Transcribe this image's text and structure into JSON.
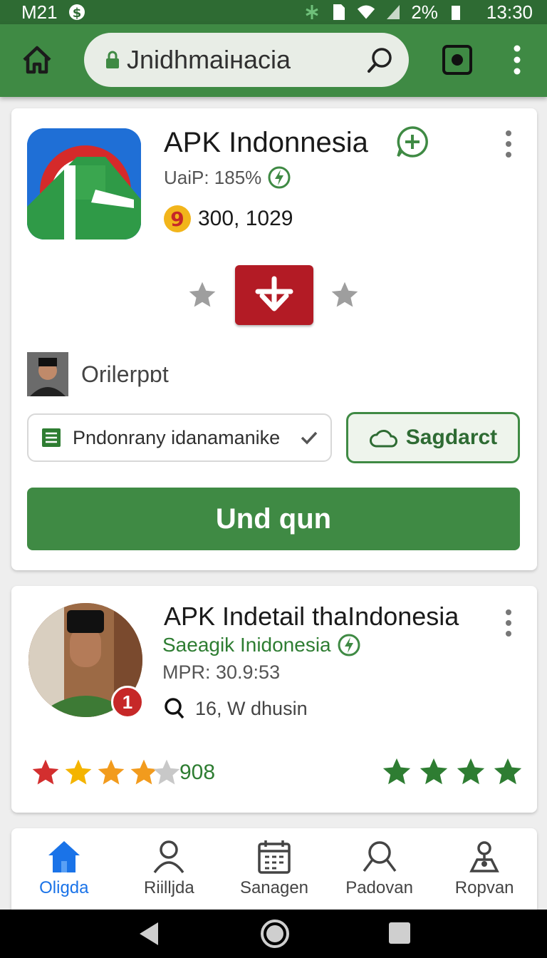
{
  "status_bar": {
    "carrier": "M21",
    "battery": "2%",
    "time": "13:30"
  },
  "toolbar": {
    "url": "Jnidhmaiнacia"
  },
  "app_card": {
    "title": "APK Indonnesia",
    "subtitle": "UaiP: 185%",
    "coins": "300, 1029",
    "author": "Orilerpɒt",
    "chip_left_label": "Pndonrany idanamanike",
    "chip_right_label": "Sagdarct",
    "main_button_label": "Und qun"
  },
  "detail_card": {
    "title": "APK Indetail  thaIndonesia",
    "subtitle": "Saeagik Inidonesia",
    "mpr": "MPR: 30.9:53",
    "search_line": "16, W dhusin",
    "badge": "1",
    "rating_count": "908",
    "left_rating_stars": 4,
    "right_rating_stars": 4
  },
  "bottom_nav": {
    "items": [
      {
        "label": "Oligda",
        "icon": "home-icon",
        "active": true
      },
      {
        "label": "Riilljda",
        "icon": "person-icon",
        "active": false
      },
      {
        "label": "Sanagen",
        "icon": "calendar-icon",
        "active": false
      },
      {
        "label": "Padovan",
        "icon": "search-icon",
        "active": false
      },
      {
        "label": "Ropvan",
        "icon": "account-icon",
        "active": false
      }
    ]
  },
  "colors": {
    "primary_green": "#3f8a44",
    "dark_green": "#2e6b33",
    "download_red": "#b31b25",
    "active_blue": "#1a73e8"
  }
}
